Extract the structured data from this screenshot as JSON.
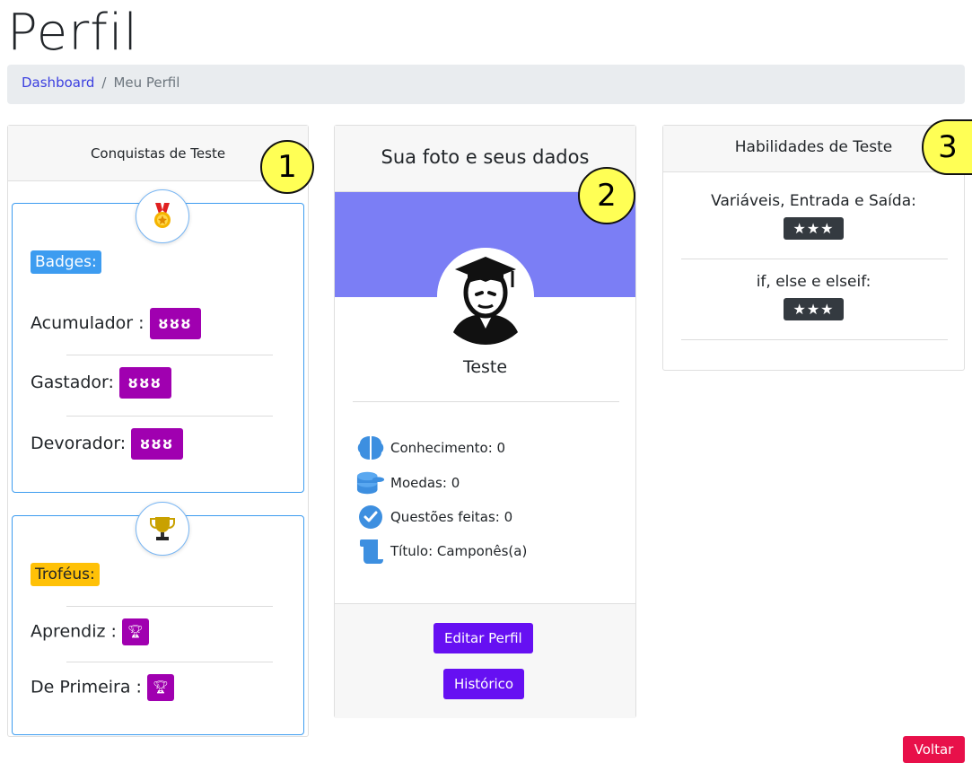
{
  "page": {
    "title": "Perfil"
  },
  "breadcrumb": {
    "home": "Dashboard",
    "separator": "/",
    "current": "Meu Perfil"
  },
  "markers": [
    "1",
    "2",
    "3"
  ],
  "achievements": {
    "header": "Conquistas de Teste",
    "badges_label": "Badges:",
    "badges": [
      {
        "label": "Acumulador :",
        "value": "ȣȣȣ"
      },
      {
        "label": "Gastador:",
        "value": "ȣȣȣ"
      },
      {
        "label": "Devorador:",
        "value": "ȣȣȣ"
      }
    ],
    "trophies_label": "Troféus:",
    "trophies": [
      {
        "label": "Aprendiz :"
      },
      {
        "label": "De Primeira :"
      }
    ]
  },
  "profile": {
    "header": "Sua foto e seus dados",
    "name": "Teste",
    "stats": {
      "knowledge": "Conhecimento: 0",
      "coins": "Moedas: 0",
      "questions": "Questões feitas: 0",
      "title": "Título: Camponês(a)"
    },
    "edit_button": "Editar Perfil",
    "history_button": "Histórico"
  },
  "skills": {
    "header": "Habilidades de Teste",
    "items": [
      {
        "name": "Variáveis, Entrada e Saída:",
        "stars": "★★★"
      },
      {
        "name": "if, else e elseif:",
        "stars": "★★★"
      }
    ]
  },
  "back_button": "Voltar",
  "colors": {
    "purple_badge": "#a000b0",
    "banner": "#7b7ef5",
    "primary_button": "#6610f2",
    "danger_button": "#e8104a",
    "info": "#3d9cf0",
    "warning": "#ffc107"
  }
}
